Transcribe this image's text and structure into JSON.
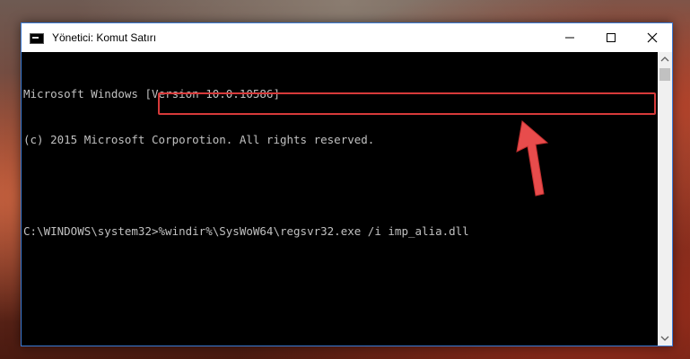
{
  "window": {
    "title": "Yönetici: Komut Satırı",
    "border_color": "#3a7bd5"
  },
  "console": {
    "lines": [
      "Microsoft Windows [Version 10.0.10586]",
      "(c) 2015 Microsoft Corporotion. All rights reserved."
    ],
    "prompt": "C:\\WINDOWS\\system32>",
    "command": "%windir%\\SysWoW64\\regsvr32.exe /i imp_alia.dll"
  },
  "annotation": {
    "highlight_color": "#d63a3a",
    "arrow_color": "#e84c4c"
  },
  "icons": {
    "minimize": "minimize-icon",
    "maximize": "maximize-icon",
    "close": "close-icon",
    "app": "cmd-icon"
  }
}
